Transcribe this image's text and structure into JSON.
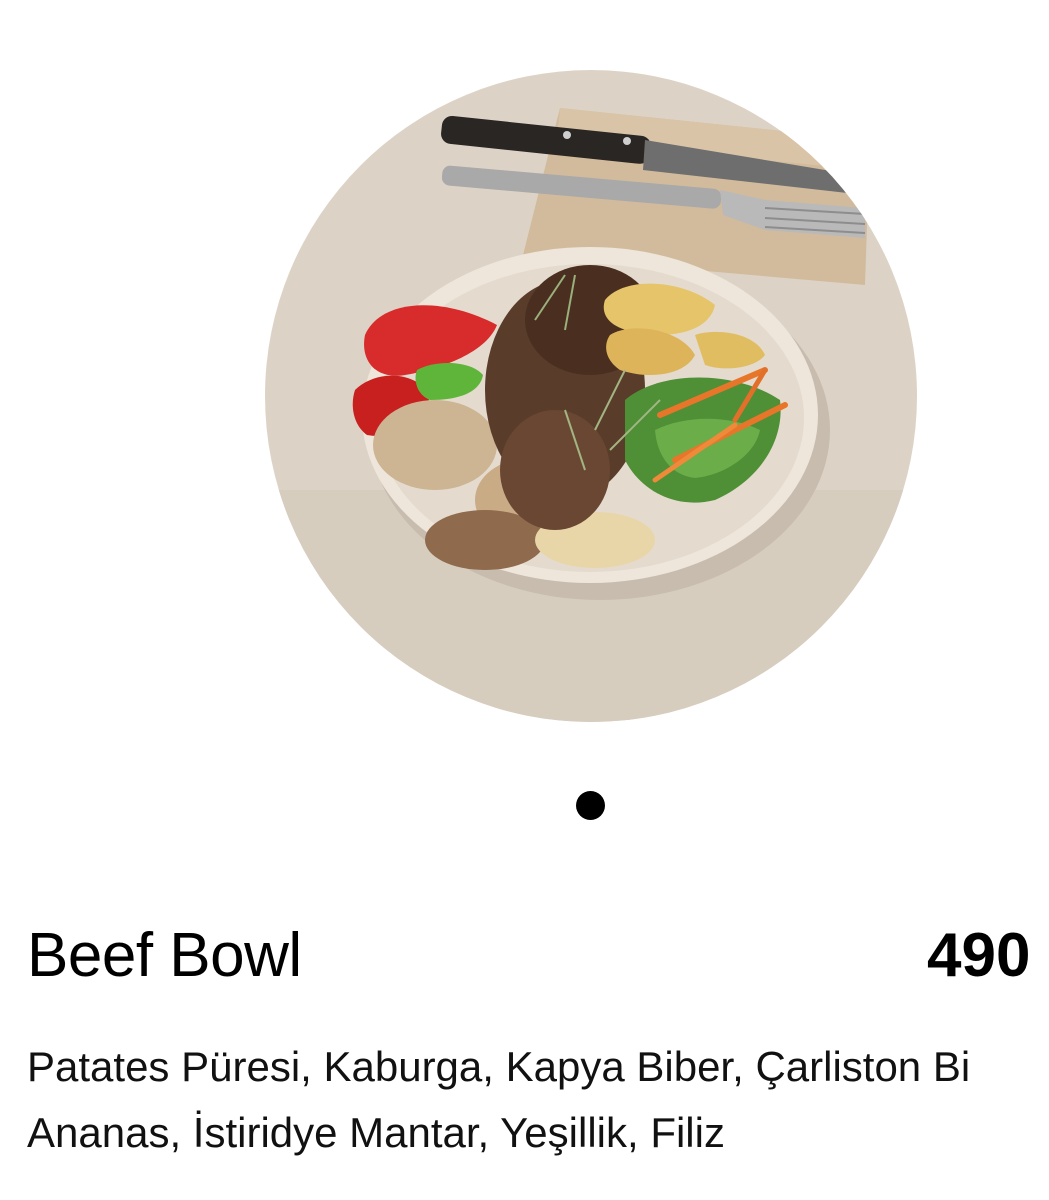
{
  "product": {
    "image": {
      "semantic": "beef-bowl-photo",
      "colors": {
        "table": "#d9d1c3",
        "napkin": "#d1b89a",
        "bowl": "#efe7dc"
      }
    },
    "pager": {
      "total_dots": 1,
      "active_index": 0
    },
    "title": "Beef Bowl",
    "price": "490",
    "description_lines": [
      "Patates Püresi, Kaburga, Kapya Biber, Çarliston Bi",
      "Ananas, İstiridye Mantar, Yeşillik, Filiz"
    ]
  }
}
